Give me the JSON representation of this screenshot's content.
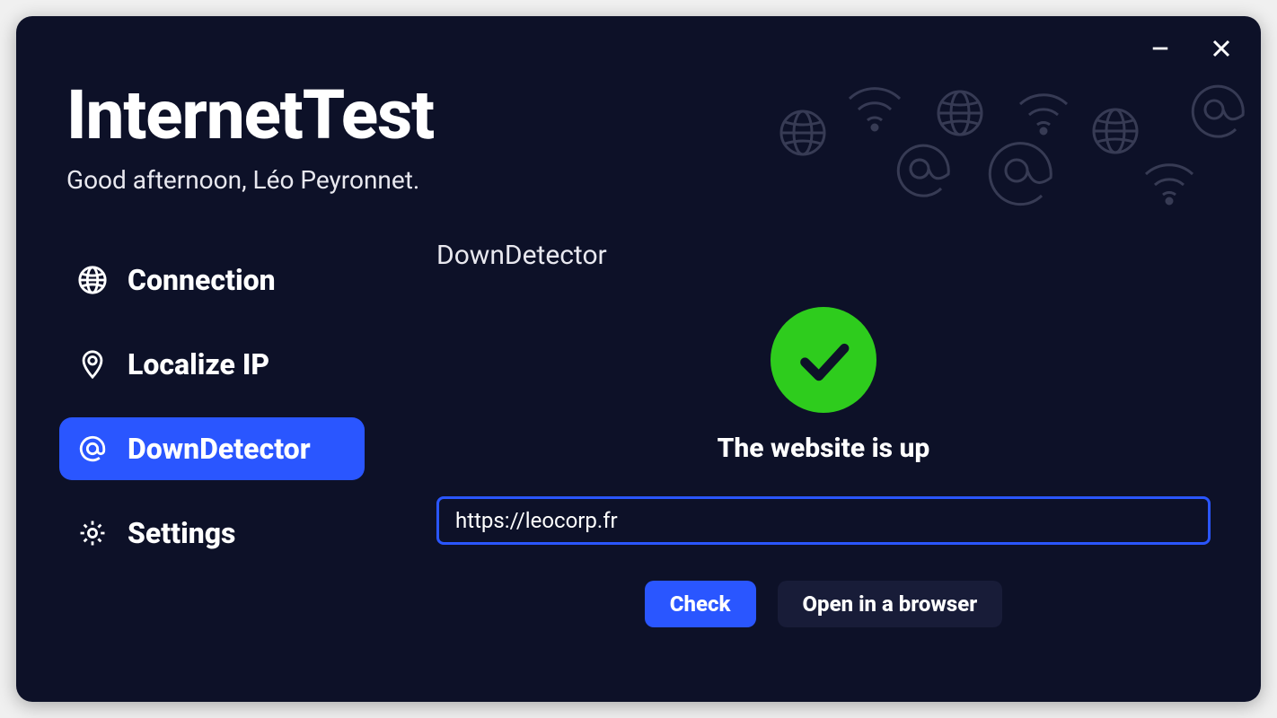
{
  "app": {
    "title": "InternetTest",
    "greeting": "Good afternoon, Léo Peyronnet."
  },
  "sidebar": {
    "items": [
      {
        "label": "Connection",
        "icon": "globe-icon",
        "active": false
      },
      {
        "label": "Localize IP",
        "icon": "pin-icon",
        "active": false
      },
      {
        "label": "DownDetector",
        "icon": "at-icon",
        "active": true
      },
      {
        "label": "Settings",
        "icon": "gear-icon",
        "active": false
      }
    ]
  },
  "main": {
    "section_title": "DownDetector",
    "status": {
      "ok": true,
      "text": "The website is up",
      "color": "#2ecc1d"
    },
    "url_value": "https://leocorp.fr",
    "actions": {
      "check_label": "Check",
      "open_label": "Open in a browser"
    }
  }
}
